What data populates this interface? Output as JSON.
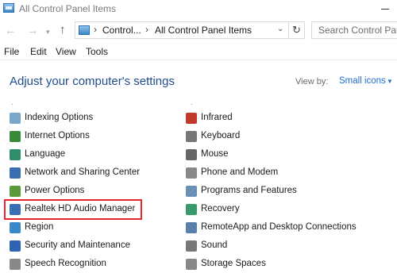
{
  "window": {
    "title": "All Control Panel Items"
  },
  "address": {
    "crumbs": [
      "Control...",
      "All Control Panel Items"
    ],
    "search_placeholder": "Search Control Pane"
  },
  "menu": [
    "File",
    "Edit",
    "View",
    "Tools"
  ],
  "content": {
    "heading": "Adjust your computer's settings",
    "view_by_label": "View by:",
    "view_by_value": "Small icons"
  },
  "left_items": [
    {
      "label": "Indexing Options",
      "icon": "indexing-icon",
      "color": "#7aa6c9"
    },
    {
      "label": "Internet Options",
      "icon": "internet-icon",
      "color": "#3a8a3a"
    },
    {
      "label": "Language",
      "icon": "language-icon",
      "color": "#2f8f6a"
    },
    {
      "label": "Network and Sharing Center",
      "icon": "network-icon",
      "color": "#3b6db0"
    },
    {
      "label": "Power Options",
      "icon": "power-icon",
      "color": "#5a9a3a"
    },
    {
      "label": "Realtek HD Audio Manager",
      "icon": "realtek-icon",
      "color": "#3a6fb6"
    },
    {
      "label": "Region",
      "icon": "region-icon",
      "color": "#3a88c9"
    },
    {
      "label": "Security and Maintenance",
      "icon": "flag-icon",
      "color": "#2f62b0"
    },
    {
      "label": "Speech Recognition",
      "icon": "microphone-icon",
      "color": "#888888"
    }
  ],
  "right_items": [
    {
      "label": "Infrared",
      "icon": "infrared-icon",
      "color": "#c0392b"
    },
    {
      "label": "Keyboard",
      "icon": "keyboard-icon",
      "color": "#777777"
    },
    {
      "label": "Mouse",
      "icon": "mouse-icon",
      "color": "#666666"
    },
    {
      "label": "Phone and Modem",
      "icon": "phone-icon",
      "color": "#888888"
    },
    {
      "label": "Programs and Features",
      "icon": "programs-icon",
      "color": "#6a8fb5"
    },
    {
      "label": "Recovery",
      "icon": "recovery-icon",
      "color": "#3a9a6a"
    },
    {
      "label": "RemoteApp and Desktop Connections",
      "icon": "remoteapp-icon",
      "color": "#5a7fa8"
    },
    {
      "label": "Sound",
      "icon": "speaker-icon",
      "color": "#777777"
    },
    {
      "label": "Storage Spaces",
      "icon": "storage-icon",
      "color": "#888888"
    }
  ],
  "highlighted_item": "Realtek HD Audio Manager",
  "highlight_color": "#e8262e"
}
